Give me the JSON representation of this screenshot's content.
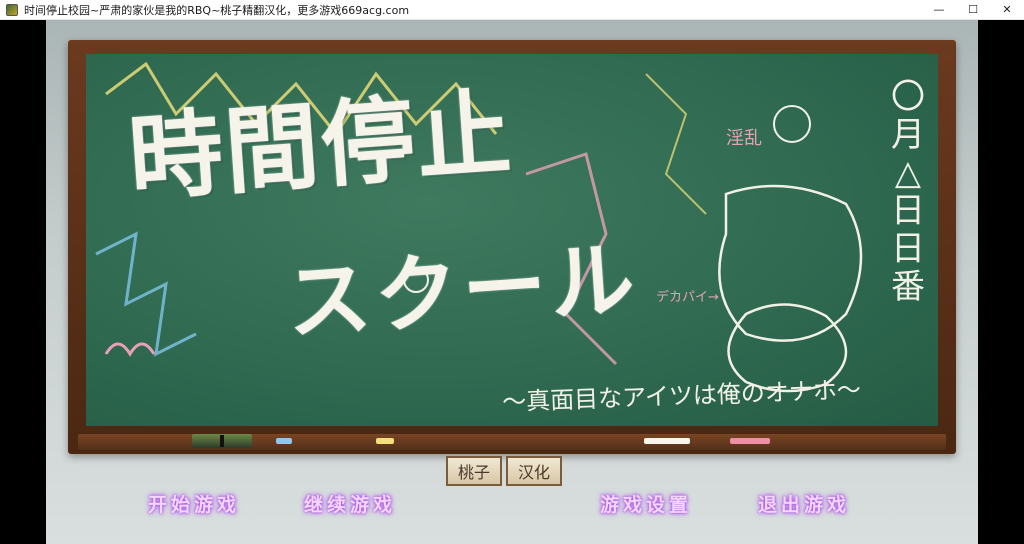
{
  "window": {
    "title": "时间停止校园~严肃的家伙是我的RBQ~桃子精翻汉化，更多游戏669acg.com",
    "minimize_glyph": "—",
    "maximize_glyph": "☐",
    "close_glyph": "✕"
  },
  "game": {
    "logo_line1": "時間停止",
    "logo_line2": "スクール",
    "logo_subtitle": "～真面目なアイツは俺のオナホ～",
    "date_chars": [
      "〇",
      "月",
      "△",
      "日",
      "日",
      "番"
    ],
    "note_left": "淫乱",
    "note_bottom": "デカパイ→",
    "language_buttons": [
      "桃子",
      "汉化"
    ],
    "menu": {
      "start": "开始游戏",
      "continue": "继续游戏",
      "settings": "游戏设置",
      "exit": "退出游戏"
    }
  },
  "colors": {
    "chalkboard": "#2f6a51",
    "frame": "#5a2f18",
    "menu_glow": "#b566ea"
  }
}
